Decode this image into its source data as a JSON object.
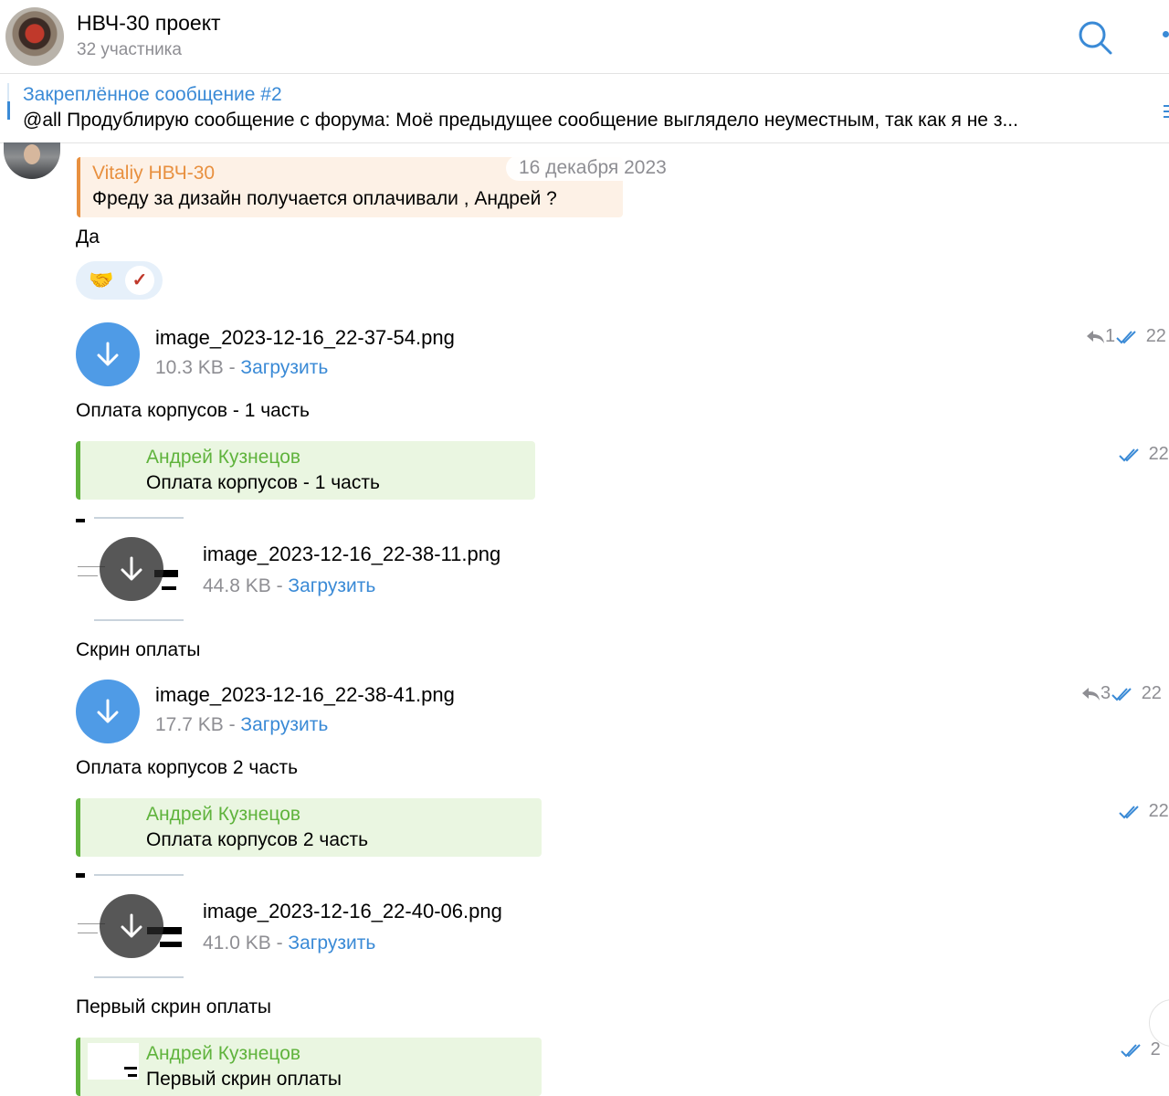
{
  "header": {
    "title": "НВЧ-30 проект",
    "subtitle": "32 участника",
    "search_icon": "search-icon"
  },
  "pinned": {
    "title": "Закреплённое сообщение #2",
    "text": "@all Продублирую сообщение с форума:  Моё предыдущее сообщение выглядело неуместным, так как я не з..."
  },
  "date_pill": "16 декабря 2023",
  "quote_reply": {
    "name": "Vitaliy НВЧ-30",
    "text": "Фреду за дизайн получается оплачивали , Андрей ?",
    "color": "#e8903f"
  },
  "reply_text": "Да",
  "reactions": {
    "emoji": "🤝",
    "avatar_char": "✓"
  },
  "files": [
    {
      "name": "image_2023-12-16_22-37-54.png",
      "size": "10.3 KB",
      "sep": " - ",
      "action": "Загрузить",
      "caption": "Оплата корпусов - 1 часть",
      "replies": "1",
      "time": "22"
    },
    {
      "name": "image_2023-12-16_22-38-11.png",
      "size": "44.8 KB",
      "sep": " - ",
      "action": "Загрузить",
      "caption": "Скрин оплаты"
    },
    {
      "name": "image_2023-12-16_22-38-41.png",
      "size": "17.7 KB",
      "sep": " - ",
      "action": "Загрузить",
      "caption": "Оплата корпусов 2 часть",
      "replies": "3",
      "time": "22"
    },
    {
      "name": "image_2023-12-16_22-40-06.png",
      "size": "41.0 KB",
      "sep": " - ",
      "action": "Загрузить",
      "caption": "Первый скрин оплаты"
    }
  ],
  "quotes": [
    {
      "name": "Андрей Кузнецов",
      "text": "Оплата корпусов - 1 часть",
      "time": "22"
    },
    {
      "name": "Андрей Кузнецов",
      "text": "Оплата корпусов 2 часть",
      "time": "22"
    },
    {
      "name": "Андрей Кузнецов",
      "text": "Первый скрин оплаты",
      "time": "2"
    }
  ],
  "colors": {
    "accent": "#3a8ad6",
    "green": "#5fb33c",
    "orange": "#e8903f"
  }
}
